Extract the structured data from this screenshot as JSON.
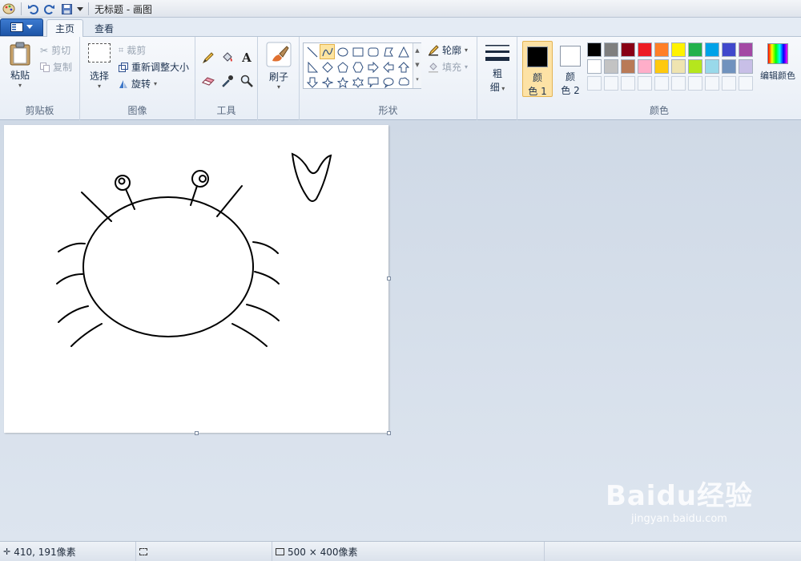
{
  "window": {
    "title": "无标题 - 画图"
  },
  "tabs": {
    "home": "主页",
    "view": "查看"
  },
  "clipboard": {
    "paste": "粘贴",
    "cut": "剪切",
    "copy": "复制",
    "label": "剪贴板"
  },
  "image": {
    "select": "选择",
    "crop": "裁剪",
    "resize": "重新调整大小",
    "rotate": "旋转",
    "label": "图像"
  },
  "tools": {
    "label": "工具",
    "text_glyph": "A"
  },
  "brushes": {
    "label": "刷子"
  },
  "shapes": {
    "outline": "轮廓",
    "fill": "填充",
    "label": "形状"
  },
  "size": {
    "label_top": "粗",
    "label_bottom": "细"
  },
  "colors": {
    "color1_top": "颜",
    "color1_bottom": "色 1",
    "color2_top": "颜",
    "color2_bottom": "色 2",
    "edit": "编辑颜色",
    "label": "颜色",
    "color1_value": "#000000",
    "color2_value": "#ffffff",
    "palette_row1": [
      "#000000",
      "#7f7f7f",
      "#880015",
      "#ed1c24",
      "#ff7f27",
      "#fff200",
      "#22b14c",
      "#00a2e8",
      "#3f48cc",
      "#a349a4"
    ],
    "palette_row2": [
      "#ffffff",
      "#c3c3c3",
      "#b97a57",
      "#ffaec9",
      "#ffc90e",
      "#efe4b0",
      "#b5e61d",
      "#99d9ea",
      "#7092be",
      "#c8bfe7"
    ]
  },
  "status": {
    "cursor": "410, 191像素",
    "canvas_size": "500 × 400像素"
  },
  "watermark": {
    "logo": "Baidu经验",
    "url": "jingyan.baidu.com"
  }
}
